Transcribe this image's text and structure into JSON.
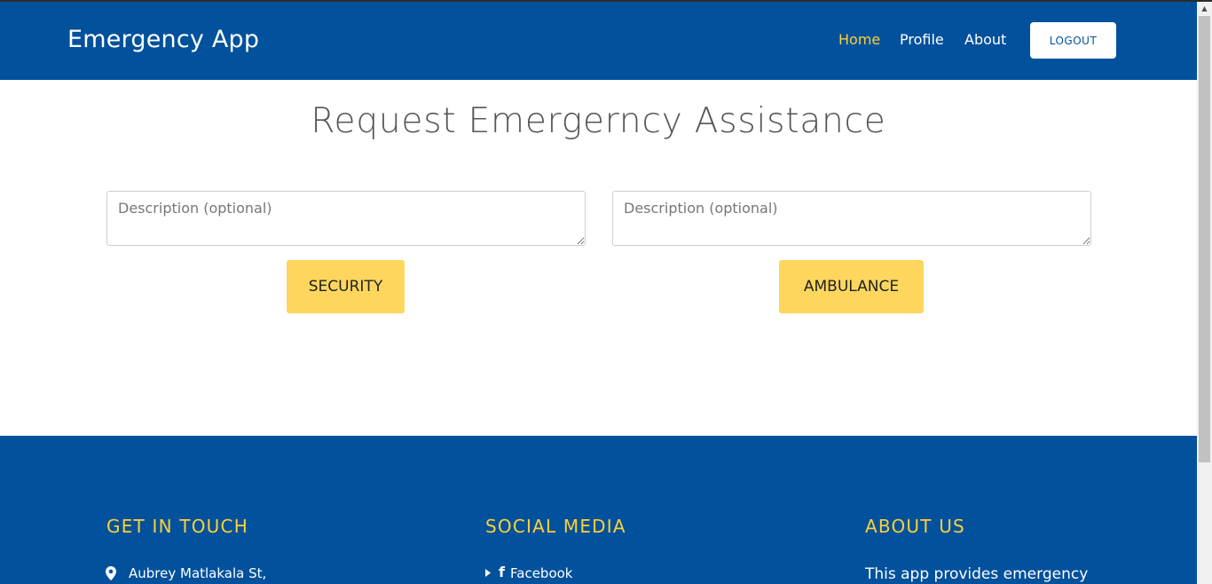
{
  "navbar": {
    "brand": "Emergency App",
    "links": [
      {
        "label": "Home",
        "active": true
      },
      {
        "label": "Profile",
        "active": false
      },
      {
        "label": "About",
        "active": false
      }
    ],
    "logout_label": "LOGOUT"
  },
  "main": {
    "title": "Request Emergerncy Assistance",
    "security": {
      "description_placeholder": "Description (optional)",
      "description_value": "",
      "button_label": "SECURITY"
    },
    "ambulance": {
      "description_placeholder": "Description (optional)",
      "description_value": "",
      "button_label": "AMBULANCE"
    }
  },
  "footer": {
    "get_in_touch": {
      "heading": "GET IN TOUCH",
      "address_line": "Aubrey Matlakala St,",
      "icon": "map-marker-icon"
    },
    "social_media": {
      "heading": "SOCIAL MEDIA",
      "links": [
        {
          "label": "Facebook",
          "icon": "facebook-icon"
        }
      ]
    },
    "about_us": {
      "heading": "ABOUT US",
      "text": "This app provides emergency"
    }
  },
  "colors": {
    "primary": "#02519c",
    "accent": "#fed136",
    "button": "#fed65e",
    "white": "#ffffff"
  }
}
